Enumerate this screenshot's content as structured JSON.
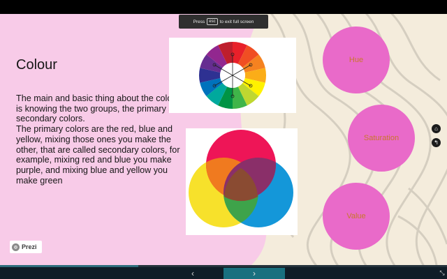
{
  "toast": {
    "prefix": "Press",
    "key": "esc",
    "suffix": "to exit full screen"
  },
  "slide": {
    "title": "Colour",
    "body": "The main and basic thing about the colors is knowing the two groups, the primary and secondary colors.\nThe primary colors are the red, blue and yellow, mixing those ones you make the other, that are called secondary colors, for example, mixing red and blue you make purple, and mixing blue and yellow you make green",
    "circles": [
      {
        "label": "Hue"
      },
      {
        "label": "Saturation"
      },
      {
        "label": "Value"
      }
    ]
  },
  "colors": {
    "pink_panel": "#f8cbe8",
    "circle_fill": "#e96ac9",
    "circle_text": "#c9772b",
    "accent": "#19707f"
  },
  "icons": {
    "home": "home-icon",
    "back": "back-arrow-icon",
    "prev": "chevron-left-icon",
    "next": "chevron-right-icon",
    "fullscreen": "fullscreen-exit-icon"
  },
  "branding": {
    "name": "Prezi"
  },
  "progress": {
    "fraction": 0.31
  }
}
